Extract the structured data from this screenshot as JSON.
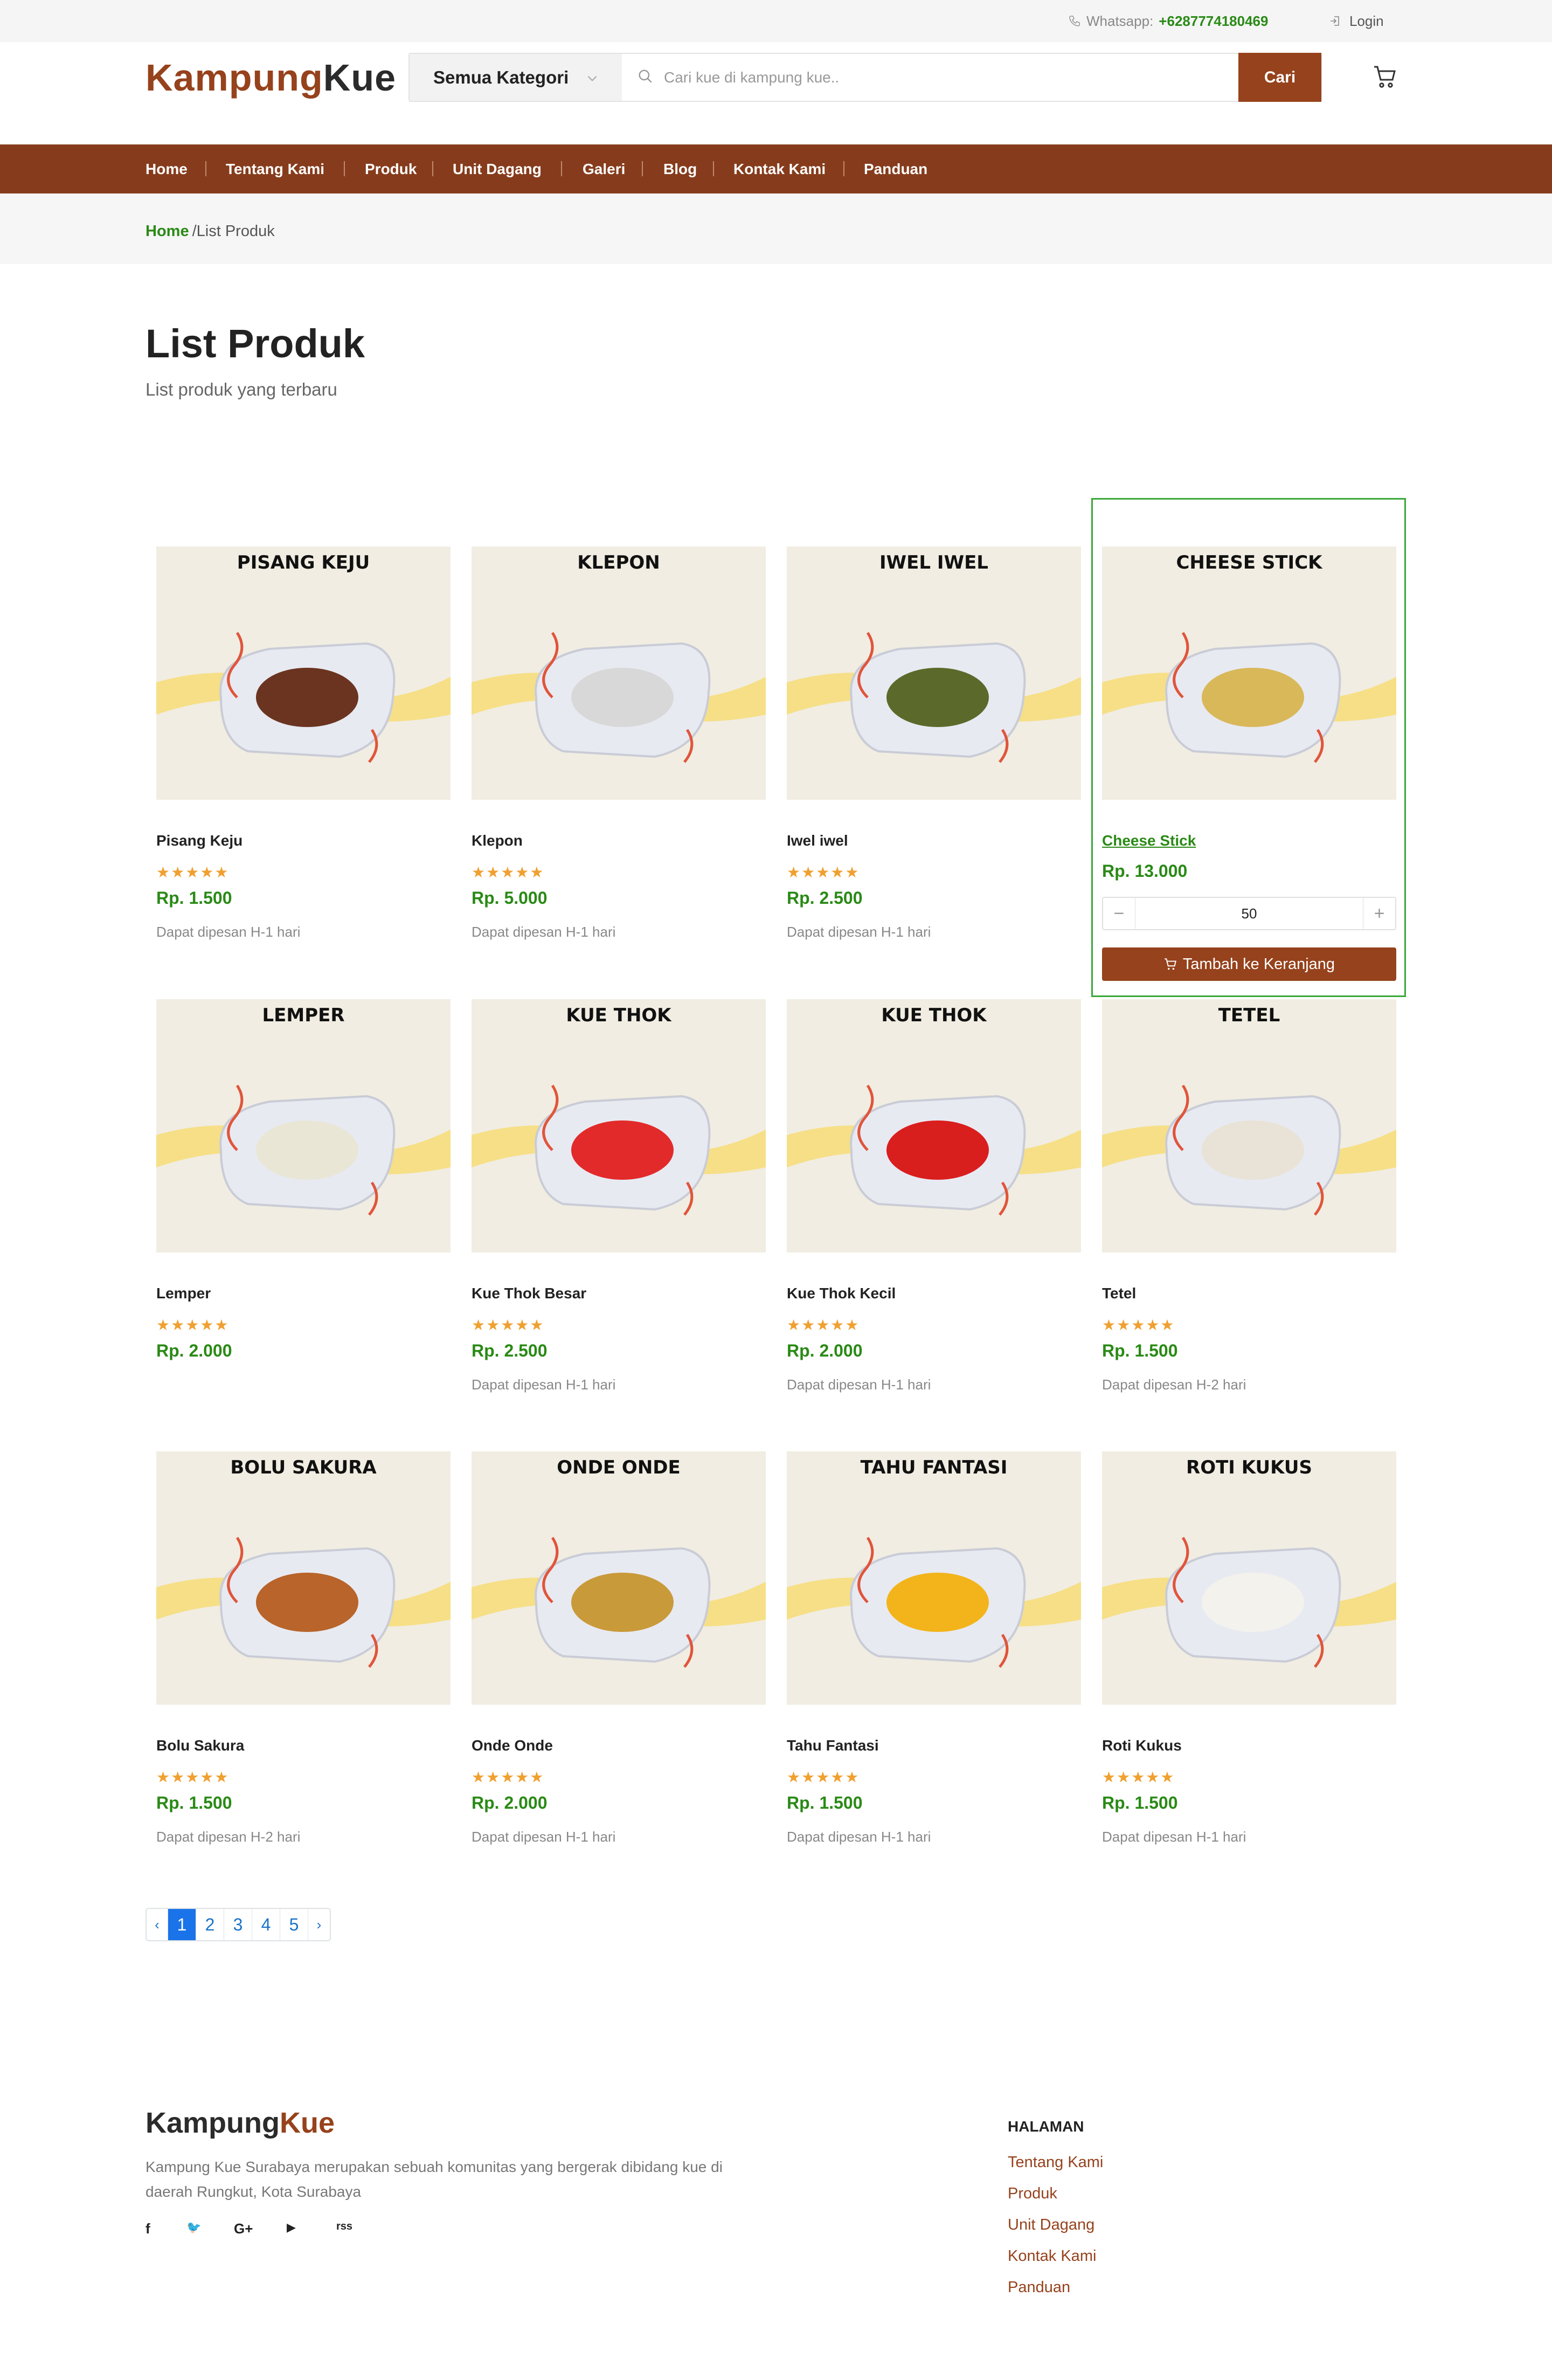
{
  "topbar": {
    "whatsapp_label": "Whatsapp:",
    "whatsapp_number": "+6287774180469",
    "login_label": "Login"
  },
  "header": {
    "logo_part1": "Kampung",
    "logo_part2": "Kue",
    "category_label": "Semua Kategori",
    "search_placeholder": "Cari kue di kampung kue..",
    "search_button": "Cari"
  },
  "nav": [
    "Home",
    "Tentang Kami",
    "Produk",
    "Unit Dagang",
    "Galeri",
    "Blog",
    "Kontak Kami",
    "Panduan"
  ],
  "breadcrumb": {
    "home": "Home",
    "current": "/List Produk"
  },
  "page": {
    "title": "List Produk",
    "subtitle": "List produk yang terbaru"
  },
  "products": [
    {
      "image_text": "PISANG KEJU",
      "name": "Pisang Keju",
      "rating": "★★★★★",
      "price": "Rp. 1.500",
      "note": "Dapat dipesan H-1 hari"
    },
    {
      "image_text": "KLEPON",
      "name": "Klepon",
      "rating": "★★★★★",
      "price": "Rp. 5.000",
      "note": "Dapat dipesan H-1 hari"
    },
    {
      "image_text": "IWEL IWEL",
      "name": "Iwel iwel",
      "rating": "★★★★★",
      "price": "Rp. 2.500",
      "note": "Dapat dipesan H-1 hari"
    },
    {
      "image_text": "CHEESE STICK",
      "name": "Cheese Stick",
      "rating": "",
      "price": "Rp. 13.000",
      "note": "",
      "quantity": "50",
      "add_to_cart": "Tambah ke Keranjang"
    },
    {
      "image_text": "LEMPER",
      "name": "Lemper",
      "rating": "★★★★★",
      "price": "Rp. 2.000",
      "note": ""
    },
    {
      "image_text": "KUE THOK",
      "name": "Kue Thok Besar",
      "rating": "★★★★★",
      "price": "Rp. 2.500",
      "note": "Dapat dipesan H-1 hari"
    },
    {
      "image_text": "KUE THOK",
      "name": "Kue Thok Kecil",
      "rating": "★★★★★",
      "price": "Rp. 2.000",
      "note": "Dapat dipesan H-1 hari"
    },
    {
      "image_text": "TETEL",
      "name": "Tetel",
      "rating": "★★★★★",
      "price": "Rp. 1.500",
      "note": "Dapat dipesan H-2 hari"
    },
    {
      "image_text": "BOLU SAKURA",
      "name": "Bolu Sakura",
      "rating": "★★★★★",
      "price": "Rp. 1.500",
      "note": "Dapat dipesan H-2 hari"
    },
    {
      "image_text": "ONDE ONDE",
      "name": "Onde Onde",
      "rating": "★★★★★",
      "price": "Rp. 2.000",
      "note": "Dapat dipesan H-1 hari"
    },
    {
      "image_text": "TAHU FANTASI",
      "name": "Tahu Fantasi",
      "rating": "★★★★★",
      "price": "Rp. 1.500",
      "note": "Dapat dipesan H-1 hari"
    },
    {
      "image_text": "ROTI KUKUS",
      "name": "Roti Kukus",
      "rating": "★★★★★",
      "price": "Rp. 1.500",
      "note": "Dapat dipesan H-1 hari"
    }
  ],
  "pagination": {
    "prev": "‹",
    "pages": [
      "1",
      "2",
      "3",
      "4",
      "5"
    ],
    "next": "›",
    "active": "1"
  },
  "footer": {
    "logo_part1": "Kampung",
    "logo_part2": "Kue",
    "description": "Kampung Kue Surabaya merupakan sebuah komunitas yang bergerak dibidang kue di daerah Rungkut, Kota Surabaya",
    "social": [
      "f",
      "🐦",
      "G+",
      "▶",
      "rss"
    ],
    "halaman_heading": "HALAMAN",
    "halaman_links": [
      "Tentang Kami",
      "Produk",
      "Unit Dagang",
      "Kontak Kami",
      "Panduan"
    ]
  },
  "colors": {
    "brand": "#96421c",
    "nav": "#863c1c",
    "price": "#2a8a16",
    "star": "#f0a030"
  }
}
